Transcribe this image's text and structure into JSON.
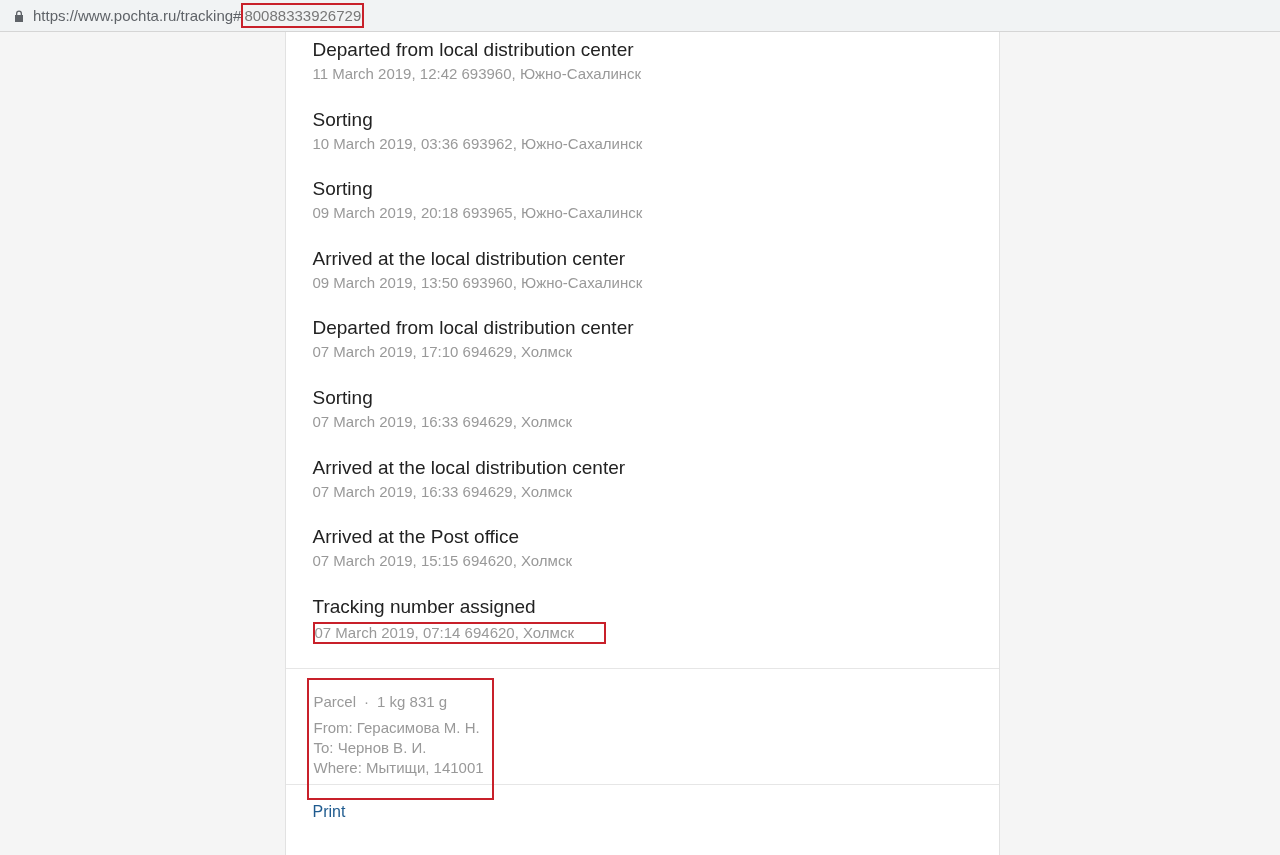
{
  "address_bar": {
    "url_base": "https://www.pochta.ru/tracking#",
    "url_fragment": "80088333926729",
    "fragment_highlighted": true
  },
  "events": [
    {
      "title": "Departed from local distribution center",
      "details": "11 March 2019, 12:42 693960, Южно-Сахалинск",
      "highlighted": false
    },
    {
      "title": "Sorting",
      "details": "10 March 2019, 03:36 693962, Южно-Сахалинск",
      "highlighted": false
    },
    {
      "title": "Sorting",
      "details": "09 March 2019, 20:18 693965, Южно-Сахалинск",
      "highlighted": false
    },
    {
      "title": "Arrived at the local distribution center",
      "details": "09 March 2019, 13:50 693960, Южно-Сахалинск",
      "highlighted": false
    },
    {
      "title": "Departed from local distribution center",
      "details": "07 March 2019, 17:10 694629, Холмск",
      "highlighted": false
    },
    {
      "title": "Sorting",
      "details": "07 March 2019, 16:33 694629, Холмск",
      "highlighted": false
    },
    {
      "title": "Arrived at the local distribution center",
      "details": "07 March 2019, 16:33 694629, Холмск",
      "highlighted": false
    },
    {
      "title": "Arrived at the Post office",
      "details": "07 March 2019, 15:15 694620, Холмск",
      "highlighted": false
    },
    {
      "title": "Tracking number assigned",
      "details": "07 March 2019, 07:14 694620, Холмск",
      "highlighted": true
    }
  ],
  "parcel": {
    "type": "Parcel",
    "separator": "·",
    "weight": "1 kg 831 g",
    "from": "From: Герасимова М. Н.",
    "to": "To: Чернов В. И.",
    "where": "Where: Мытищи, 141001",
    "highlighted": true
  },
  "print_link": "Print"
}
